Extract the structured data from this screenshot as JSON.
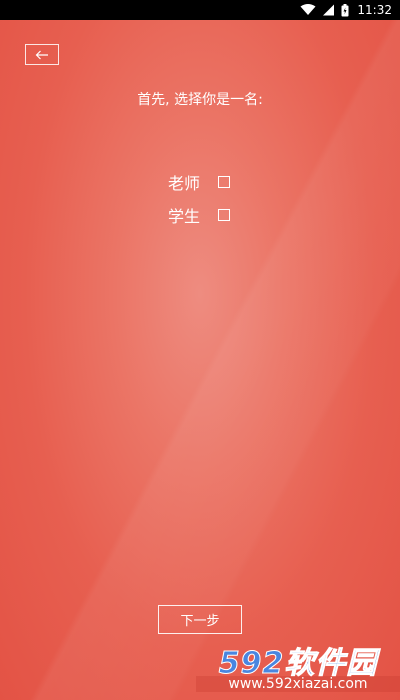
{
  "status_bar": {
    "time": "11:32",
    "icons": [
      "wifi-icon",
      "signal-icon",
      "battery-icon"
    ]
  },
  "header": {
    "back_icon": "arrow-left-icon"
  },
  "prompt": "首先, 选择你是一名:",
  "options": [
    {
      "label": "老师",
      "checked": false
    },
    {
      "label": "学生",
      "checked": false
    }
  ],
  "next_button": "下一步",
  "watermark": {
    "logo": "592软件园",
    "url": "www.592xiazai.com"
  },
  "colors": {
    "background": "#e75f50",
    "foreground": "#ffffff",
    "watermark_blue": "#4a86e0"
  }
}
